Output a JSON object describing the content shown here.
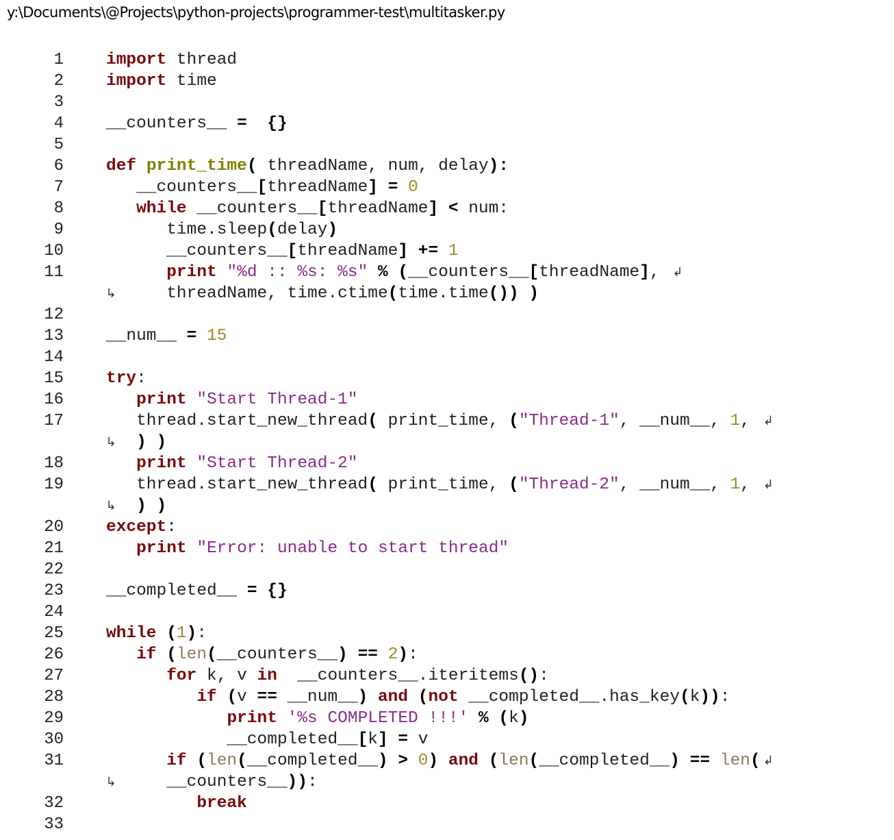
{
  "window": {
    "file_path": "y:\\Documents\\@Projects\\python-projects\\programmer-test\\multitasker.py"
  },
  "icons": {
    "wrap_out": "line-wrap-arrow-icon",
    "wrap_in": "line-continuation-arrow-icon"
  },
  "colors": {
    "keyword": "#7a0a0a",
    "function_name": "#7f7f00",
    "string": "#8a2b8a",
    "number": "#9a8c2a",
    "builtin": "#8a7a5a",
    "operator": "#000000",
    "plain": "#222222"
  },
  "code_lines": [
    {
      "n": "1",
      "tokens": [
        [
          "kw",
          "import"
        ],
        [
          "pl",
          " thread"
        ]
      ]
    },
    {
      "n": "2",
      "tokens": [
        [
          "kw",
          "import"
        ],
        [
          "pl",
          " time"
        ]
      ]
    },
    {
      "n": "3",
      "tokens": []
    },
    {
      "n": "4",
      "tokens": [
        [
          "pl",
          "__counters__ "
        ],
        [
          "op",
          "="
        ],
        [
          "pl",
          "  "
        ],
        [
          "op",
          "{}"
        ]
      ]
    },
    {
      "n": "5",
      "tokens": []
    },
    {
      "n": "6",
      "tokens": [
        [
          "kw",
          "def"
        ],
        [
          "pl",
          " "
        ],
        [
          "fn",
          "print_time"
        ],
        [
          "op",
          "("
        ],
        [
          "pl",
          " threadName, num, delay"
        ],
        [
          "op",
          "):"
        ]
      ]
    },
    {
      "n": "7",
      "tokens": [
        [
          "pl",
          "   __counters__"
        ],
        [
          "op",
          "["
        ],
        [
          "pl",
          "threadName"
        ],
        [
          "op",
          "]"
        ],
        [
          "pl",
          " "
        ],
        [
          "op",
          "="
        ],
        [
          "pl",
          " "
        ],
        [
          "num",
          "0"
        ]
      ]
    },
    {
      "n": "8",
      "tokens": [
        [
          "pl",
          "   "
        ],
        [
          "kw",
          "while"
        ],
        [
          "pl",
          " __counters__"
        ],
        [
          "op",
          "["
        ],
        [
          "pl",
          "threadName"
        ],
        [
          "op",
          "]"
        ],
        [
          "pl",
          " "
        ],
        [
          "op",
          "<"
        ],
        [
          "pl",
          " num:"
        ]
      ]
    },
    {
      "n": "9",
      "tokens": [
        [
          "pl",
          "      time.sleep"
        ],
        [
          "op",
          "("
        ],
        [
          "pl",
          "delay"
        ],
        [
          "op",
          ")"
        ]
      ]
    },
    {
      "n": "10",
      "tokens": [
        [
          "pl",
          "      __counters__"
        ],
        [
          "op",
          "["
        ],
        [
          "pl",
          "threadName"
        ],
        [
          "op",
          "]"
        ],
        [
          "pl",
          " "
        ],
        [
          "op",
          "+="
        ],
        [
          "pl",
          " "
        ],
        [
          "num",
          "1"
        ]
      ]
    },
    {
      "n": "11",
      "wrap": true,
      "tokens": [
        [
          "pl",
          "      "
        ],
        [
          "kw",
          "print"
        ],
        [
          "pl",
          " "
        ],
        [
          "str",
          "\"%d :: %s: %s\""
        ],
        [
          "pl",
          " "
        ],
        [
          "op",
          "%"
        ],
        [
          "pl",
          " "
        ],
        [
          "op",
          "("
        ],
        [
          "pl",
          "__counters__"
        ],
        [
          "op",
          "["
        ],
        [
          "pl",
          "threadName"
        ],
        [
          "op",
          "]"
        ],
        [
          "pl",
          ", "
        ]
      ]
    },
    {
      "n": "",
      "cont": true,
      "tokens": [
        [
          "pl",
          "      threadName, time.ctime"
        ],
        [
          "op",
          "("
        ],
        [
          "pl",
          "time.time"
        ],
        [
          "op",
          "()"
        ],
        [
          "op",
          ")"
        ],
        [
          "pl",
          " "
        ],
        [
          "op",
          ")"
        ]
      ]
    },
    {
      "n": "12",
      "tokens": []
    },
    {
      "n": "13",
      "tokens": [
        [
          "pl",
          "__num__ "
        ],
        [
          "op",
          "="
        ],
        [
          "pl",
          " "
        ],
        [
          "num",
          "15"
        ]
      ]
    },
    {
      "n": "14",
      "tokens": []
    },
    {
      "n": "15",
      "tokens": [
        [
          "kw",
          "try"
        ],
        [
          "pl",
          ":"
        ]
      ]
    },
    {
      "n": "16",
      "tokens": [
        [
          "pl",
          "   "
        ],
        [
          "kw",
          "print"
        ],
        [
          "pl",
          " "
        ],
        [
          "str",
          "\"Start Thread-1\""
        ]
      ]
    },
    {
      "n": "17",
      "wrap": true,
      "tokens": [
        [
          "pl",
          "   thread.start_new_thread"
        ],
        [
          "op",
          "("
        ],
        [
          "pl",
          " print_time, "
        ],
        [
          "op",
          "("
        ],
        [
          "str",
          "\"Thread-1\""
        ],
        [
          "pl",
          ", __num__, "
        ],
        [
          "num",
          "1"
        ],
        [
          "pl",
          ", "
        ]
      ]
    },
    {
      "n": "",
      "cont": true,
      "tokens": [
        [
          "pl",
          "   "
        ],
        [
          "op",
          ")"
        ],
        [
          "pl",
          " "
        ],
        [
          "op",
          ")"
        ]
      ]
    },
    {
      "n": "18",
      "tokens": [
        [
          "pl",
          "   "
        ],
        [
          "kw",
          "print"
        ],
        [
          "pl",
          " "
        ],
        [
          "str",
          "\"Start Thread-2\""
        ]
      ]
    },
    {
      "n": "19",
      "wrap": true,
      "tokens": [
        [
          "pl",
          "   thread.start_new_thread"
        ],
        [
          "op",
          "("
        ],
        [
          "pl",
          " print_time, "
        ],
        [
          "op",
          "("
        ],
        [
          "str",
          "\"Thread-2\""
        ],
        [
          "pl",
          ", __num__, "
        ],
        [
          "num",
          "1"
        ],
        [
          "pl",
          ", "
        ]
      ]
    },
    {
      "n": "",
      "cont": true,
      "tokens": [
        [
          "pl",
          "   "
        ],
        [
          "op",
          ")"
        ],
        [
          "pl",
          " "
        ],
        [
          "op",
          ")"
        ]
      ]
    },
    {
      "n": "20",
      "tokens": [
        [
          "kw",
          "except"
        ],
        [
          "pl",
          ":"
        ]
      ]
    },
    {
      "n": "21",
      "tokens": [
        [
          "pl",
          "   "
        ],
        [
          "kw",
          "print"
        ],
        [
          "pl",
          " "
        ],
        [
          "str",
          "\"Error: unable to start thread\""
        ]
      ]
    },
    {
      "n": "22",
      "tokens": []
    },
    {
      "n": "23",
      "tokens": [
        [
          "pl",
          "__completed__ "
        ],
        [
          "op",
          "="
        ],
        [
          "pl",
          " "
        ],
        [
          "op",
          "{}"
        ]
      ]
    },
    {
      "n": "24",
      "tokens": []
    },
    {
      "n": "25",
      "tokens": [
        [
          "kw",
          "while"
        ],
        [
          "pl",
          " "
        ],
        [
          "op",
          "("
        ],
        [
          "num",
          "1"
        ],
        [
          "op",
          ")"
        ],
        [
          "pl",
          ":"
        ]
      ]
    },
    {
      "n": "26",
      "tokens": [
        [
          "pl",
          "   "
        ],
        [
          "kw",
          "if"
        ],
        [
          "pl",
          " "
        ],
        [
          "op",
          "("
        ],
        [
          "bi",
          "len"
        ],
        [
          "op",
          "("
        ],
        [
          "pl",
          "__counters__"
        ],
        [
          "op",
          ")"
        ],
        [
          "pl",
          " "
        ],
        [
          "op",
          "=="
        ],
        [
          "pl",
          " "
        ],
        [
          "num",
          "2"
        ],
        [
          "op",
          ")"
        ],
        [
          "pl",
          ":"
        ]
      ]
    },
    {
      "n": "27",
      "tokens": [
        [
          "pl",
          "      "
        ],
        [
          "kw",
          "for"
        ],
        [
          "pl",
          " k, v "
        ],
        [
          "kw",
          "in"
        ],
        [
          "pl",
          "  __counters__.iteritems"
        ],
        [
          "op",
          "()"
        ],
        [
          "pl",
          ":"
        ]
      ]
    },
    {
      "n": "28",
      "tokens": [
        [
          "pl",
          "         "
        ],
        [
          "kw",
          "if"
        ],
        [
          "pl",
          " "
        ],
        [
          "op",
          "("
        ],
        [
          "pl",
          "v "
        ],
        [
          "op",
          "=="
        ],
        [
          "pl",
          " __num__"
        ],
        [
          "op",
          ")"
        ],
        [
          "pl",
          " "
        ],
        [
          "kw",
          "and"
        ],
        [
          "pl",
          " "
        ],
        [
          "op",
          "("
        ],
        [
          "kw",
          "not"
        ],
        [
          "pl",
          " __completed__.has_key"
        ],
        [
          "op",
          "("
        ],
        [
          "pl",
          "k"
        ],
        [
          "op",
          "))"
        ],
        [
          "pl",
          ":"
        ]
      ]
    },
    {
      "n": "29",
      "tokens": [
        [
          "pl",
          "            "
        ],
        [
          "kw",
          "print"
        ],
        [
          "pl",
          " "
        ],
        [
          "str",
          "'%s COMPLETED !!!'"
        ],
        [
          "pl",
          " "
        ],
        [
          "op",
          "%"
        ],
        [
          "pl",
          " "
        ],
        [
          "op",
          "("
        ],
        [
          "pl",
          "k"
        ],
        [
          "op",
          ")"
        ]
      ]
    },
    {
      "n": "30",
      "tokens": [
        [
          "pl",
          "            __completed__"
        ],
        [
          "op",
          "["
        ],
        [
          "pl",
          "k"
        ],
        [
          "op",
          "]"
        ],
        [
          "pl",
          " "
        ],
        [
          "op",
          "="
        ],
        [
          "pl",
          " v"
        ]
      ]
    },
    {
      "n": "31",
      "wrap": true,
      "tokens": [
        [
          "pl",
          "      "
        ],
        [
          "kw",
          "if"
        ],
        [
          "pl",
          " "
        ],
        [
          "op",
          "("
        ],
        [
          "bi",
          "len"
        ],
        [
          "op",
          "("
        ],
        [
          "pl",
          "__completed__"
        ],
        [
          "op",
          ")"
        ],
        [
          "pl",
          " "
        ],
        [
          "op",
          ">"
        ],
        [
          "pl",
          " "
        ],
        [
          "num",
          "0"
        ],
        [
          "op",
          ")"
        ],
        [
          "pl",
          " "
        ],
        [
          "kw",
          "and"
        ],
        [
          "pl",
          " "
        ],
        [
          "op",
          "("
        ],
        [
          "bi",
          "len"
        ],
        [
          "op",
          "("
        ],
        [
          "pl",
          "__completed__"
        ],
        [
          "op",
          ")"
        ],
        [
          "pl",
          " "
        ],
        [
          "op",
          "=="
        ],
        [
          "pl",
          " "
        ],
        [
          "bi",
          "len"
        ],
        [
          "op",
          "("
        ]
      ]
    },
    {
      "n": "",
      "cont": true,
      "tokens": [
        [
          "pl",
          "      __counters__"
        ],
        [
          "op",
          "))"
        ],
        [
          "pl",
          ":"
        ]
      ]
    },
    {
      "n": "32",
      "tokens": [
        [
          "pl",
          "         "
        ],
        [
          "kw",
          "break"
        ]
      ]
    },
    {
      "n": "33",
      "tokens": []
    }
  ]
}
